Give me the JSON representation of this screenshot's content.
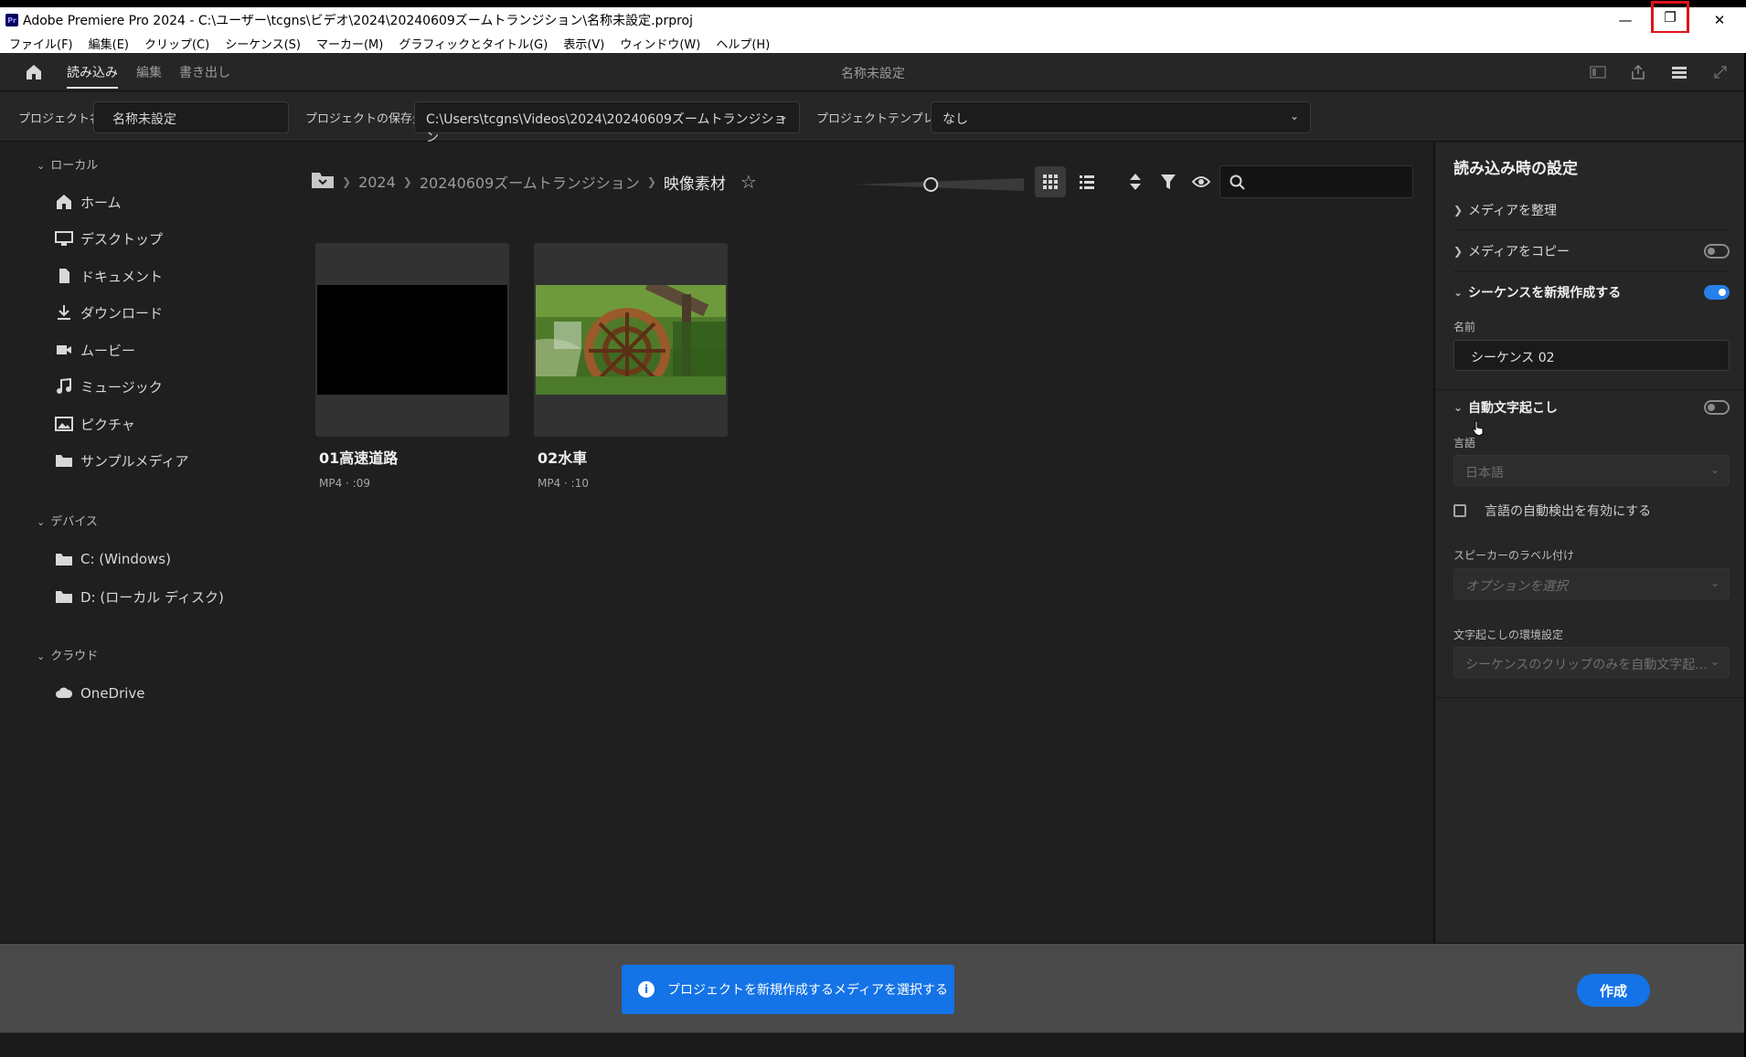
{
  "window": {
    "title": "Adobe Premiere Pro 2024 - C:\\ユーザー\\tcgns\\ビデオ\\2024\\20240609ズームトランジション\\名称未設定.prproj",
    "logo_text": "Pr",
    "min_glyph": "—",
    "restore_glyph": "❐",
    "close_glyph": "✕"
  },
  "menu": [
    "ファイル(F)",
    "編集(E)",
    "クリップ(C)",
    "シーケンス(S)",
    "マーカー(M)",
    "グラフィックとタイトル(G)",
    "表示(V)",
    "ウィンドウ(W)",
    "ヘルプ(H)"
  ],
  "header": {
    "tabs": [
      "読み込み",
      "編集",
      "書き出し"
    ],
    "active_tab": "読み込み",
    "center_title": "名称未設定"
  },
  "project": {
    "name_label": "プロジェクト名",
    "name_value": "名称未設定",
    "location_label": "プロジェクトの保存先",
    "location_value": "C:\\Users\\tcgns\\Videos\\2024\\20240609ズームトランジション",
    "template_label": "プロジェクトテンプレート",
    "template_value": "なし"
  },
  "leftnav": {
    "local_label": "ローカル",
    "local_items": [
      {
        "label": "ホーム",
        "icon": "home-icon"
      },
      {
        "label": "デスクトップ",
        "icon": "desktop-icon"
      },
      {
        "label": "ドキュメント",
        "icon": "document-icon"
      },
      {
        "label": "ダウンロード",
        "icon": "download-icon"
      },
      {
        "label": "ムービー",
        "icon": "video-icon"
      },
      {
        "label": "ミュージック",
        "icon": "music-icon"
      },
      {
        "label": "ピクチャ",
        "icon": "picture-icon"
      },
      {
        "label": "サンプルメディア",
        "icon": "folder-icon"
      }
    ],
    "devices_label": "デバイス",
    "device_items": [
      {
        "label": "C: (Windows)",
        "icon": "folder-icon"
      },
      {
        "label": "D: (ローカル ディスク)",
        "icon": "folder-icon"
      }
    ],
    "cloud_label": "クラウド",
    "cloud_items": [
      {
        "label": "OneDrive",
        "icon": "cloud-icon"
      }
    ]
  },
  "browser": {
    "breadcrumb": [
      "2024",
      "20240609ズームトランジション"
    ],
    "current_folder": "映像素材",
    "thumbnail_size": 0.45,
    "view_mode": "grid",
    "search_placeholder": "",
    "items": [
      {
        "name": "01高速道路",
        "meta": "MP4 · :09"
      },
      {
        "name": "02水車",
        "meta": "MP4 · :10"
      }
    ]
  },
  "settings": {
    "title": "読み込み時の設定",
    "organize_media": "メディアを整理",
    "copy_media": "メディアをコピー",
    "copy_media_on": false,
    "new_sequence": "シーケンスを新規作成する",
    "new_sequence_on": true,
    "name_label": "名前",
    "sequence_name": "シーケンス 02",
    "auto_transcribe": "自動文字起こし",
    "auto_transcribe_on": false,
    "language_label": "言語",
    "language_value": "日本語",
    "auto_detect_label": "言語の自動検出を有効にする",
    "speaker_label": "スピーカーのラベル付け",
    "speaker_placeholder": "オプションを選択",
    "transcribe_pref_label": "文字起こしの環境設定",
    "transcribe_pref_value": "シーケンスのクリップのみを自動文字起..."
  },
  "bottom": {
    "notice": "プロジェクトを新規作成するメディアを選択する",
    "create_button": "作成"
  },
  "colors": {
    "accent": "#1473e6",
    "highlight_box": "#e0121a"
  }
}
